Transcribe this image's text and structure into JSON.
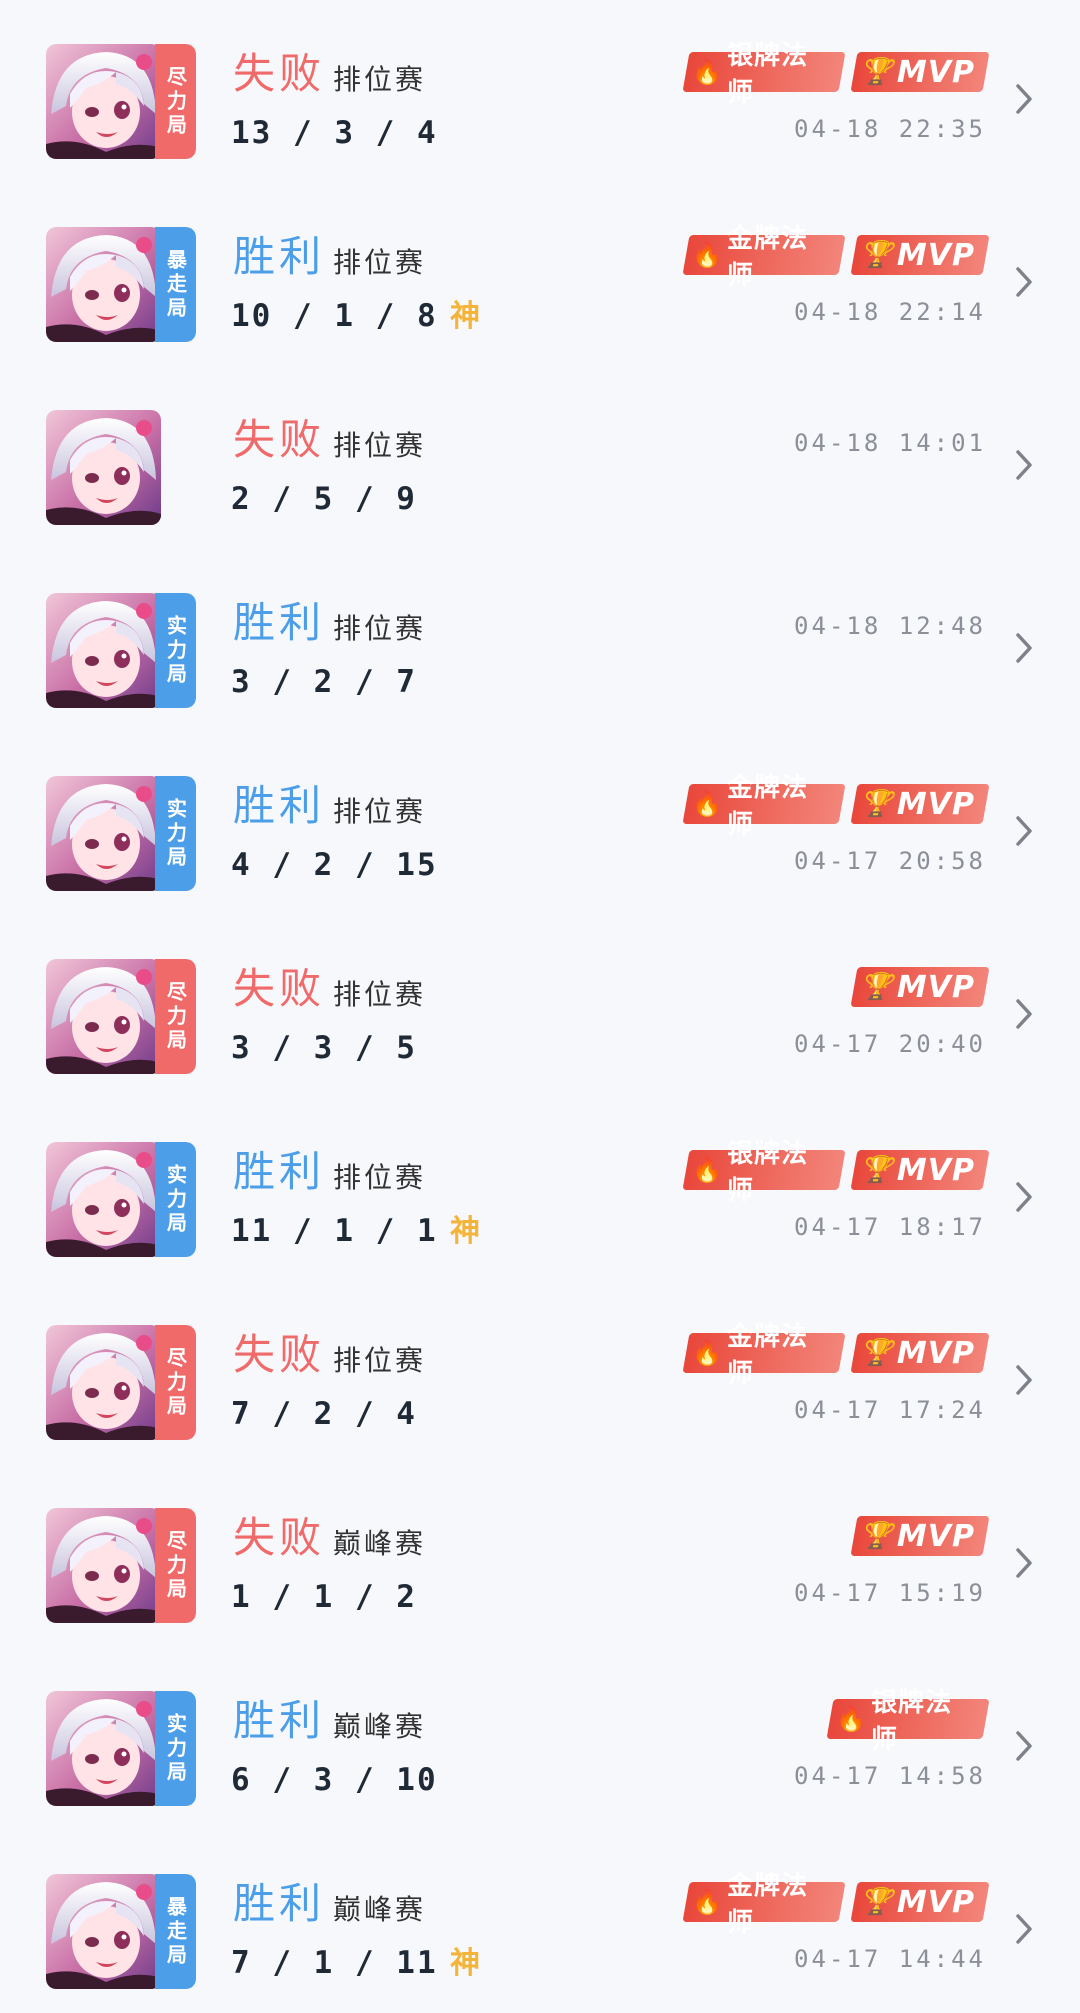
{
  "god_label": "神",
  "matches": [
    {
      "ribbon": "尽力局",
      "ribbon_color": "red",
      "result": "失败",
      "outcome": "lose",
      "mode": "排位赛",
      "kda": "13/3/4",
      "god": false,
      "rank_badge": "银牌法师",
      "mvp_badge": "MVP",
      "time": "04-18 22:35"
    },
    {
      "ribbon": "暴走局",
      "ribbon_color": "blue",
      "result": "胜利",
      "outcome": "win",
      "mode": "排位赛",
      "kda": "10/1/8",
      "god": true,
      "rank_badge": "金牌法师",
      "mvp_badge": "MVP",
      "time": "04-18 22:14"
    },
    {
      "ribbon": "",
      "ribbon_color": "none",
      "result": "失败",
      "outcome": "lose",
      "mode": "排位赛",
      "kda": "2/5/9",
      "god": false,
      "rank_badge": "",
      "mvp_badge": "",
      "time": "04-18 14:01"
    },
    {
      "ribbon": "实力局",
      "ribbon_color": "blue",
      "result": "胜利",
      "outcome": "win",
      "mode": "排位赛",
      "kda": "3/2/7",
      "god": false,
      "rank_badge": "",
      "mvp_badge": "",
      "time": "04-18 12:48"
    },
    {
      "ribbon": "实力局",
      "ribbon_color": "blue",
      "result": "胜利",
      "outcome": "win",
      "mode": "排位赛",
      "kda": "4/2/15",
      "god": false,
      "rank_badge": "金牌法师",
      "mvp_badge": "MVP",
      "time": "04-17 20:58"
    },
    {
      "ribbon": "尽力局",
      "ribbon_color": "red",
      "result": "失败",
      "outcome": "lose",
      "mode": "排位赛",
      "kda": "3/3/5",
      "god": false,
      "rank_badge": "",
      "mvp_badge": "MVP",
      "time": "04-17 20:40"
    },
    {
      "ribbon": "实力局",
      "ribbon_color": "blue",
      "result": "胜利",
      "outcome": "win",
      "mode": "排位赛",
      "kda": "11/1/1",
      "god": true,
      "rank_badge": "银牌法师",
      "mvp_badge": "MVP",
      "time": "04-17 18:17"
    },
    {
      "ribbon": "尽力局",
      "ribbon_color": "red",
      "result": "失败",
      "outcome": "lose",
      "mode": "排位赛",
      "kda": "7/2/4",
      "god": false,
      "rank_badge": "金牌法师",
      "mvp_badge": "MVP",
      "time": "04-17 17:24"
    },
    {
      "ribbon": "尽力局",
      "ribbon_color": "red",
      "result": "失败",
      "outcome": "lose",
      "mode": "巅峰赛",
      "kda": "1/1/2",
      "god": false,
      "rank_badge": "",
      "mvp_badge": "MVP",
      "time": "04-17 15:19"
    },
    {
      "ribbon": "实力局",
      "ribbon_color": "blue",
      "result": "胜利",
      "outcome": "win",
      "mode": "巅峰赛",
      "kda": "6/3/10",
      "god": false,
      "rank_badge": "银牌法师",
      "mvp_badge": "",
      "time": "04-17 14:58"
    },
    {
      "ribbon": "暴走局",
      "ribbon_color": "blue",
      "result": "胜利",
      "outcome": "win",
      "mode": "巅峰赛",
      "kda": "7/1/11",
      "god": true,
      "rank_badge": "金牌法师",
      "mvp_badge": "MVP",
      "time": "04-17 14:44"
    }
  ],
  "colors": {
    "win": "#4d9ee8",
    "lose": "#f06a6a",
    "god": "#f4b43a",
    "badge": "#e9473b"
  },
  "icons": {
    "hero_avatar": "hero-portrait",
    "chevron": "chevron-right-icon",
    "rank": "flame-icon",
    "mvp": "trophy-icon"
  }
}
